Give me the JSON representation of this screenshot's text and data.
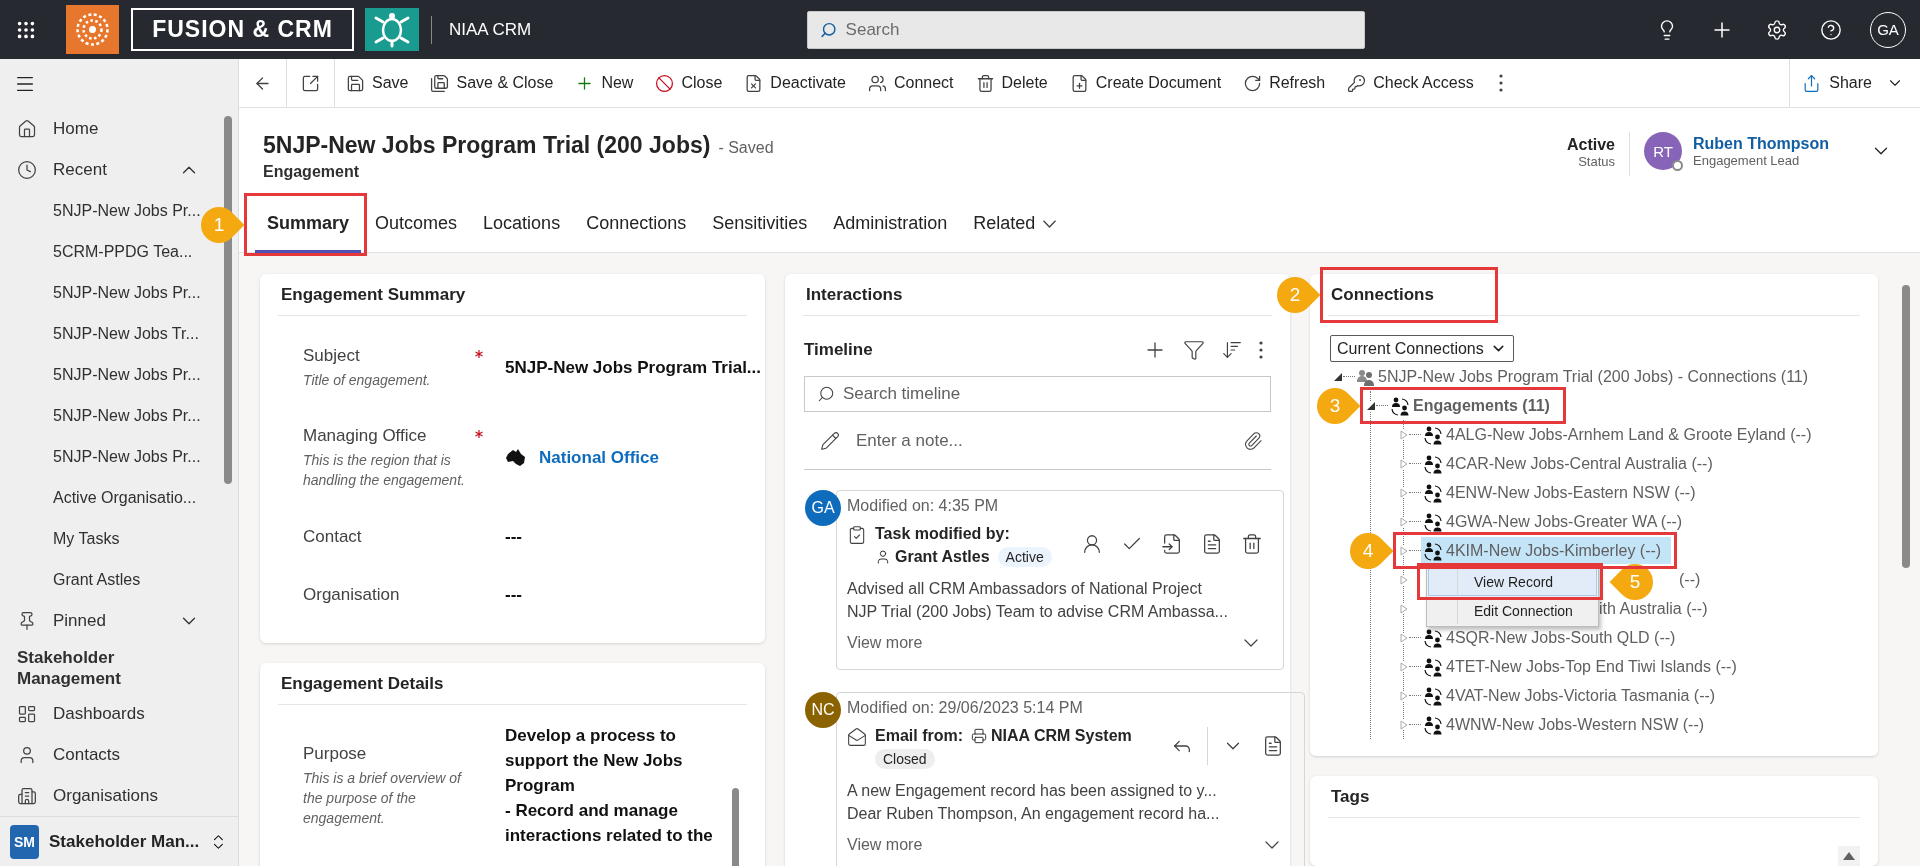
{
  "app_bar": {
    "logo_text": "FUSION & CRM",
    "app_name": "NIAA CRM",
    "search": {
      "placeholder": "Search"
    },
    "user_initials": "GA"
  },
  "sidebar": {
    "nav": [
      {
        "label": "Home",
        "kind": "home"
      },
      {
        "label": "Recent",
        "kind": "recent",
        "expanded": true
      }
    ],
    "recent_items": [
      "5NJP-New Jobs Pr...",
      "5CRM-PPDG Tea...",
      "5NJP-New Jobs Pr...",
      "5NJP-New Jobs Tr...",
      "5NJP-New Jobs Pr...",
      "5NJP-New Jobs Pr...",
      "5NJP-New Jobs Pr...",
      "Active Organisatio...",
      "My Tasks",
      "Grant Astles"
    ],
    "pinned": {
      "label": "Pinned",
      "expanded": false
    },
    "section_title": "Stakeholder Management",
    "items": [
      {
        "label": "Dashboards",
        "kind": "dashboard"
      },
      {
        "label": "Contacts",
        "kind": "contact"
      },
      {
        "label": "Organisations",
        "kind": "organisation"
      }
    ],
    "area": {
      "initials": "SM",
      "label": "Stakeholder Man..."
    }
  },
  "command_bar": {
    "items": [
      {
        "kind": "back"
      },
      {
        "kind": "popout"
      },
      {
        "kind": "save",
        "label": "Save"
      },
      {
        "kind": "save_close",
        "label": "Save & Close"
      },
      {
        "kind": "new",
        "label": "New"
      },
      {
        "kind": "close",
        "label": "Close"
      },
      {
        "kind": "deactivate",
        "label": "Deactivate"
      },
      {
        "kind": "connect",
        "label": "Connect"
      },
      {
        "kind": "delete",
        "label": "Delete"
      },
      {
        "kind": "document",
        "label": "Create Document"
      },
      {
        "kind": "refresh",
        "label": "Refresh"
      },
      {
        "kind": "access",
        "label": "Check Access"
      },
      {
        "kind": "more"
      }
    ],
    "share": {
      "label": "Share"
    }
  },
  "record": {
    "title": "5NJP-New Jobs Program Trial (200 Jobs)",
    "save_state": "- Saved",
    "entity": "Engagement",
    "status": {
      "value": "Active",
      "label": "Status"
    },
    "owner": {
      "initials": "RT",
      "name": "Ruben Thompson",
      "role": "Engagement Lead"
    }
  },
  "tabs": [
    {
      "label": "Summary",
      "selected": true,
      "callout": "1"
    },
    {
      "label": "Outcomes",
      "selected": false
    },
    {
      "label": "Locations",
      "selected": false
    },
    {
      "label": "Connections",
      "selected": false
    },
    {
      "label": "Sensitivities",
      "selected": false
    },
    {
      "label": "Administration",
      "selected": false
    },
    {
      "label": "Related",
      "selected": false,
      "kind": "menu"
    }
  ],
  "summary_card": {
    "title": "Engagement Summary",
    "fields": [
      {
        "label": "Subject",
        "required": true,
        "description_lines": [
          "Title of engagement."
        ],
        "value_lines": [
          "5NJP-New Jobs Program Trial..."
        ],
        "kind": "text"
      },
      {
        "label": "Managing Office",
        "required": true,
        "description_lines": [
          "This is the region that is",
          "handling the engagement."
        ],
        "value_lines": [
          "National Office"
        ],
        "kind": "lookup"
      },
      {
        "label": "Contact",
        "required": false,
        "value_lines": [
          "---"
        ],
        "kind": "text"
      },
      {
        "label": "Organisation",
        "required": false,
        "value_lines": [
          "---"
        ],
        "kind": "text"
      }
    ]
  },
  "details_card": {
    "title": "Engagement Details",
    "fields": [
      {
        "label": "Purpose",
        "required": false,
        "description_lines": [
          "This is a brief overview of",
          "the purpose of the",
          "engagement."
        ],
        "value_lines": [
          "Develop a process to",
          "support the New Jobs",
          "Program",
          "- Record and manage",
          "interactions related to the"
        ],
        "kind": "multiline"
      }
    ]
  },
  "interactions": {
    "title": "Interactions",
    "timeline": {
      "title": "Timeline",
      "search": {
        "placeholder": "Search timeline"
      },
      "note": {
        "placeholder": "Enter a note..."
      },
      "items": [
        {
          "initials": "GA",
          "color": "#0f6cbd",
          "modified": "Modified on: 4:35 PM",
          "kind": "task",
          "heading": "Task modified by:",
          "party": "Grant Astles",
          "status": {
            "label": "Active",
            "kind": "active"
          },
          "body_lines": [
            "Advised all CRM Ambassadors of National Project",
            "NJP Trial (200 Jobs) Team to advise CRM Ambassa..."
          ],
          "more": "View more"
        },
        {
          "initials": "NC",
          "color": "#8a6200",
          "modified": "Modified on: 29/06/2023 5:14 PM",
          "kind": "email",
          "heading": "Email from:",
          "party": "NIAA CRM System",
          "status": {
            "label": "Closed",
            "kind": "closed"
          },
          "body_lines": [
            "A new Engagement record has been assigned to y...",
            "Dear Ruben Thompson, An engagement record ha..."
          ],
          "more": "View more"
        }
      ]
    }
  },
  "connections": {
    "title": "Connections",
    "callout": "2",
    "view": {
      "value": "Current Connections"
    },
    "tree": [
      {
        "label": "5NJP-New Jobs Program Trial (200 Jobs) - Connections (11)",
        "kind": "group",
        "expanded": true,
        "selected": false,
        "children": [
          {
            "label": "Engagements (11)",
            "kind": "category",
            "expanded": true,
            "selected": false,
            "callout": "3",
            "children": [
              {
                "label": "4ALG-New Jobs-Arnhem Land & Groote Eyland (--)",
                "kind": "node",
                "expanded": false,
                "selected": false
              },
              {
                "label": "4CAR-New Jobs-Central Australia (--)",
                "kind": "node",
                "expanded": false,
                "selected": false
              },
              {
                "label": "4ENW-New Jobs-Eastern NSW (--)",
                "kind": "node",
                "expanded": false,
                "selected": false
              },
              {
                "label": "4GWA-New Jobs-Greater WA (--)",
                "kind": "node",
                "expanded": false,
                "selected": false
              },
              {
                "label": "4KIM-New Jobs-Kimberley (--)",
                "kind": "node",
                "expanded": false,
                "selected": true,
                "callout": "4"
              },
              {
                "label": "(--)",
                "kind": "tail",
                "expanded": false,
                "selected": false
              },
              {
                "label": "ith Australia (--)",
                "kind": "tail",
                "expanded": false,
                "selected": false
              },
              {
                "label": "4SQR-New Jobs-South QLD (--)",
                "kind": "node",
                "expanded": false,
                "selected": false
              },
              {
                "label": "4TET-New Jobs-Top End Tiwi Islands (--)",
                "kind": "node",
                "expanded": false,
                "selected": false
              },
              {
                "label": "4VAT-New Jobs-Victoria Tasmania (--)",
                "kind": "node",
                "expanded": false,
                "selected": false
              },
              {
                "label": "4WNW-New Jobs-Western NSW (--)",
                "kind": "node",
                "expanded": false,
                "selected": false
              }
            ]
          }
        ]
      }
    ],
    "context_menu": [
      {
        "label": "View Record",
        "selected": true,
        "callout": "5"
      },
      {
        "label": "Edit Connection",
        "selected": false
      }
    ]
  },
  "tags": {
    "title": "Tags"
  }
}
